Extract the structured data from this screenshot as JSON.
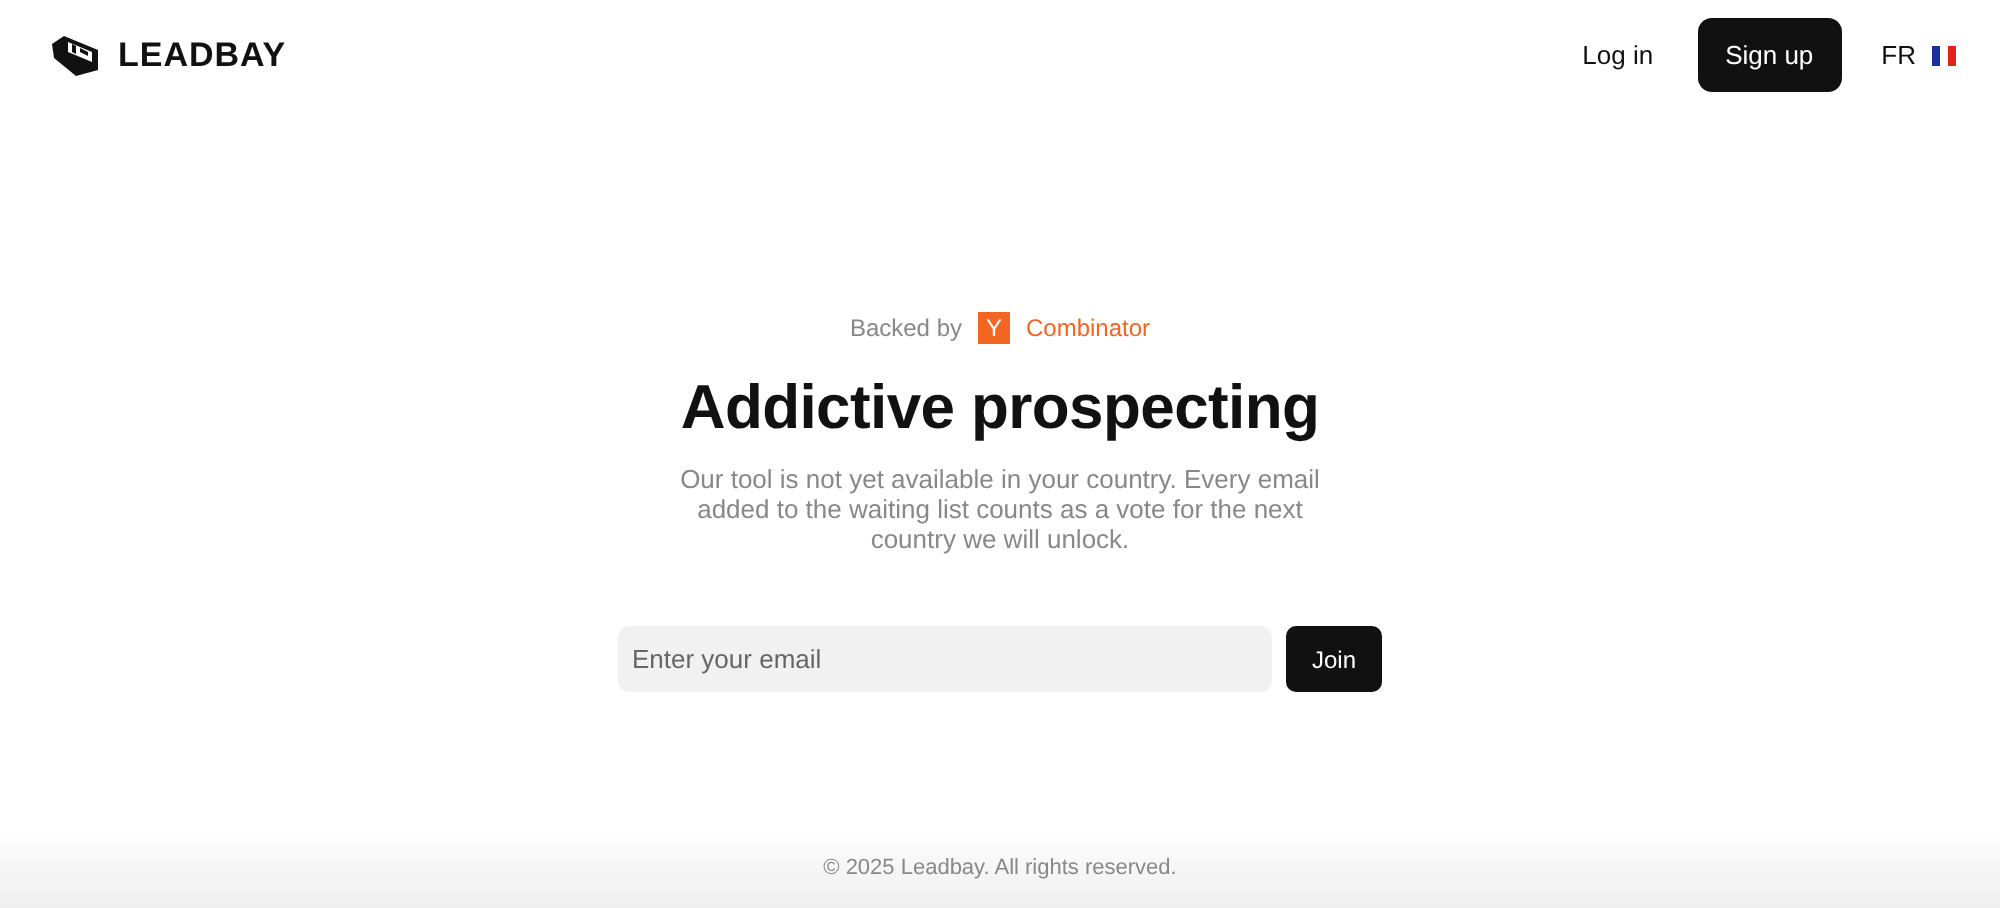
{
  "header": {
    "logo": "LEADBAY",
    "nav": [
      {
        "kind": "link",
        "label": "Log in"
      },
      {
        "kind": "button",
        "label": "Sign up"
      }
    ],
    "language": "FR"
  },
  "hero": {
    "backed_by": "Backed by",
    "badge_letter": "Y",
    "badge_name": "Combinator",
    "title": "Addictive prospecting",
    "description": "Our tool is not yet available in your country. Every email added to the waiting list counts as a vote for the next country we will unlock."
  },
  "form": {
    "placeholder": "Enter your email",
    "button": "Join"
  },
  "footer": "© 2025 Leadbay. All rights reserved."
}
